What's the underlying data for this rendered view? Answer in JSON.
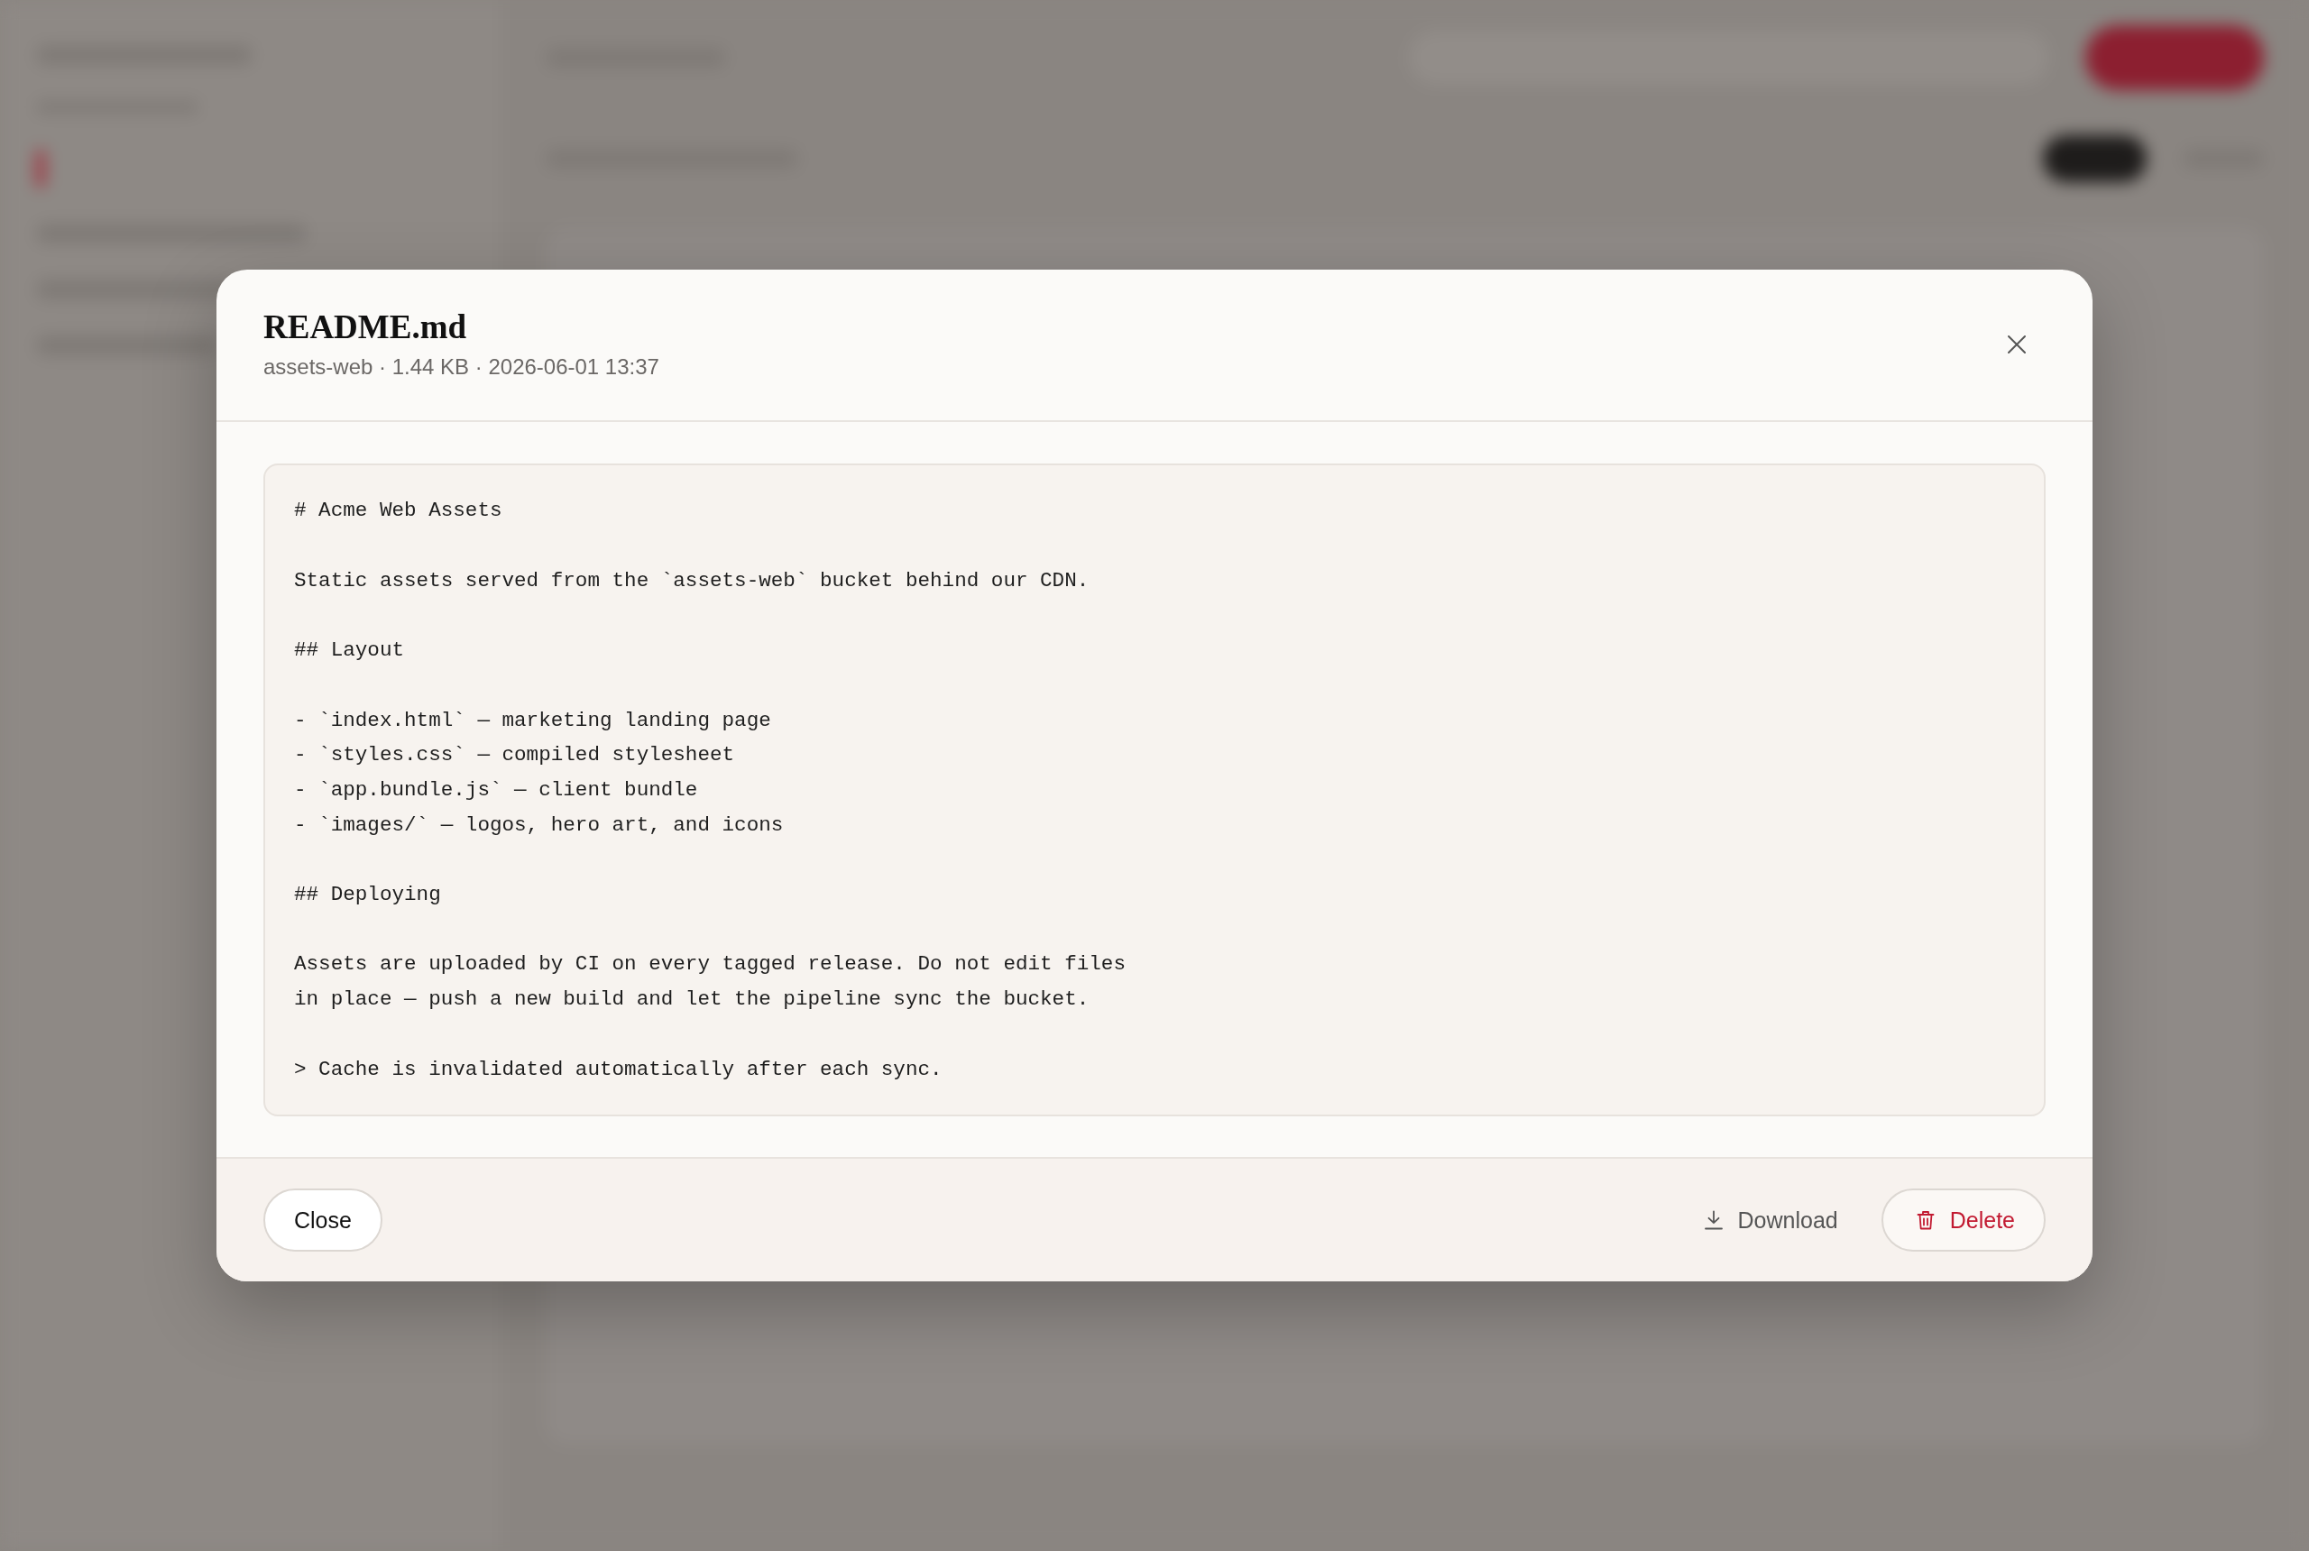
{
  "modal": {
    "title": "README.md",
    "subtitle": "assets-web · 1.44 KB · 2026-06-01 13:37"
  },
  "preview": {
    "text": "# Acme Web Assets\n\nStatic assets served from the `assets-web` bucket behind our CDN.\n\n## Layout\n\n- `index.html` — marketing landing page\n- `styles.css` — compiled stylesheet\n- `app.bundle.js` — client bundle\n- `images/` — logos, hero art, and icons\n\n## Deploying\n\nAssets are uploaded by CI on every tagged release. Do not edit files\nin place — push a new build and let the pipeline sync the bucket.\n\n> Cache is invalidated automatically after each sync."
  },
  "footer": {
    "start": [
      {
        "label": "Close",
        "kind": "dismiss"
      }
    ],
    "end": [
      {
        "label": "Download",
        "kind": "download"
      },
      {
        "label": "Delete",
        "kind": "delete"
      }
    ]
  }
}
